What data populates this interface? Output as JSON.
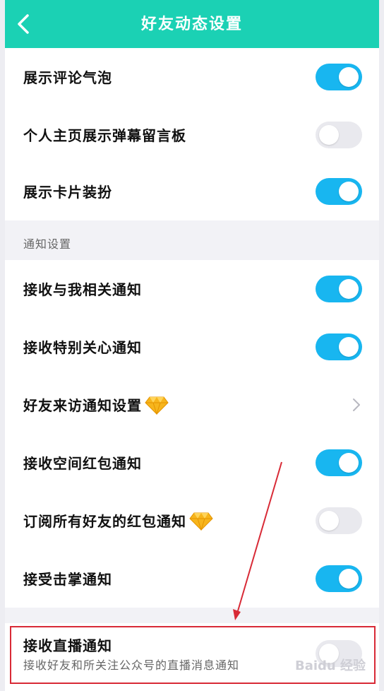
{
  "header": {
    "title": "好友动态设置"
  },
  "settings": [
    {
      "label": "展示评论气泡",
      "state": "on"
    },
    {
      "label": "个人主页展示弹幕留言板",
      "state": "off"
    },
    {
      "label": "展示卡片装扮",
      "state": "on"
    }
  ],
  "notify_section": {
    "title": "通知设置",
    "items": [
      {
        "label": "接收与我相关通知",
        "state": "on"
      },
      {
        "label": "接收特别关心通知",
        "state": "on"
      },
      {
        "label": "好友来访通知设置",
        "type": "link",
        "badge": "diamond-icon"
      },
      {
        "label": "接收空间红包通知",
        "state": "on"
      },
      {
        "label": "订阅所有好友的红包通知",
        "state": "off",
        "badge": "diamond-icon"
      },
      {
        "label": "接受击掌通知",
        "state": "on"
      }
    ]
  },
  "live": {
    "title": "接收直播通知",
    "subtitle": "接收好友和所关注公众号的直播消息通知",
    "state": "off"
  },
  "watermark": "Baidu 经验",
  "colors": {
    "header": "#1bd1b4",
    "toggle_on": "#18b6f0",
    "toggle_off": "#e9e9ee",
    "highlight": "#d82a36"
  }
}
